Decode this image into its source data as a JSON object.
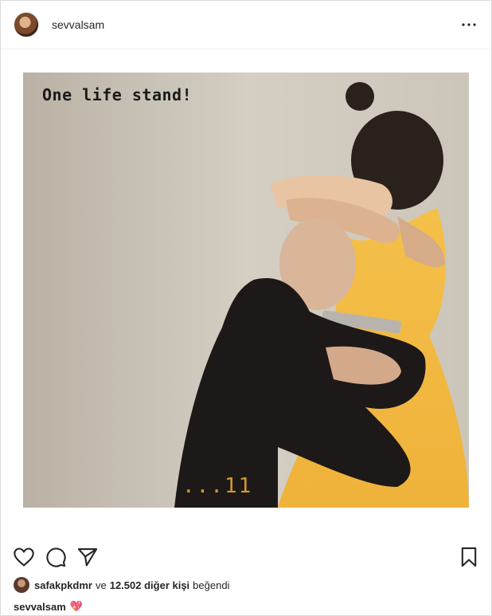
{
  "post": {
    "username": "sevvalsam",
    "overlay_text": "One life stand!",
    "counter_text": "...11"
  },
  "icons": {
    "more": "more-options-icon",
    "like": "heart-icon",
    "comment": "comment-icon",
    "share": "share-icon",
    "save": "bookmark-icon"
  },
  "likes": {
    "user": "safakpkdmr",
    "connector": "ve",
    "count": "12.502 diğer kişi",
    "suffix": "beğendi"
  },
  "caption": {
    "username": "sevvalsam",
    "emoji": "💖"
  },
  "colors": {
    "border": "#dbdbdb",
    "text": "#262626",
    "dress": "#f2b640",
    "counter": "#d79a2a"
  }
}
